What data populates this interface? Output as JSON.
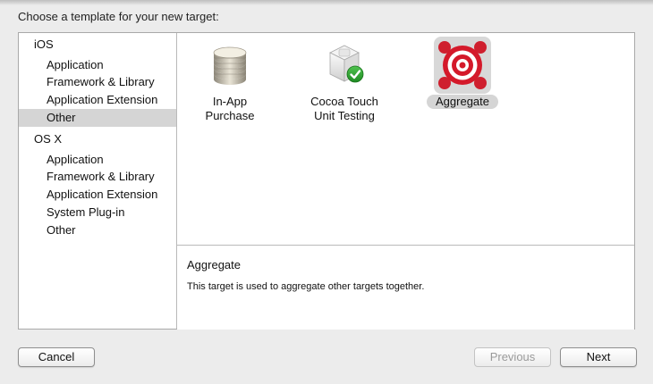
{
  "dialog": {
    "prompt": "Choose a template for your new target:"
  },
  "sidebar": {
    "groups": [
      {
        "header": "iOS",
        "items": [
          {
            "label": "Application"
          },
          {
            "label": "Framework & Library"
          },
          {
            "label": "Application Extension"
          },
          {
            "label": "Other",
            "selected": true
          }
        ]
      },
      {
        "header": "OS X",
        "items": [
          {
            "label": "Application"
          },
          {
            "label": "Framework & Library"
          },
          {
            "label": "Application Extension"
          },
          {
            "label": "System Plug-in"
          },
          {
            "label": "Other"
          }
        ]
      }
    ]
  },
  "templates": [
    {
      "label_line1": "In-App",
      "label_line2": "Purchase",
      "icon": "coin-stack-icon"
    },
    {
      "label_line1": "Cocoa Touch",
      "label_line2": "Unit Testing",
      "icon": "test-bundle-icon"
    },
    {
      "label_line1": "Aggregate",
      "label_line2": "",
      "icon": "aggregate-target-icon",
      "selected": true
    }
  ],
  "detail": {
    "title": "Aggregate",
    "description": "This target is used to aggregate other targets together."
  },
  "buttons": {
    "cancel": "Cancel",
    "previous": "Previous",
    "next": "Next"
  },
  "colors": {
    "selection_gray": "#d5d5d5",
    "aggregate_red": "#d4192a",
    "check_green": "#27a12b"
  }
}
